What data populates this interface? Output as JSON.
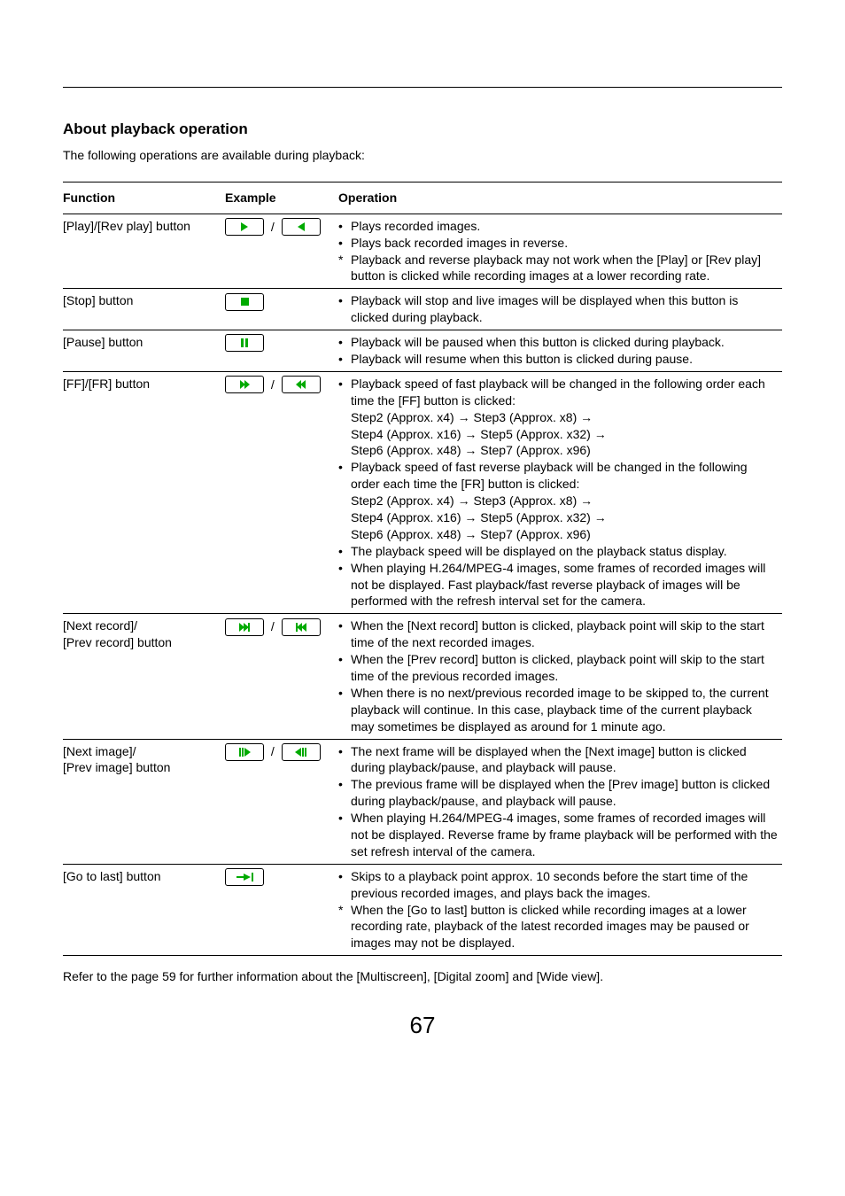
{
  "section_title": "About playback operation",
  "intro": "The following operations are available during playback:",
  "table": {
    "headers": {
      "fn": "Function",
      "ex": "Example",
      "op": "Operation"
    },
    "rows": [
      {
        "fn": "[Play]/[Rev play] button",
        "sep": "/",
        "op": [
          {
            "m": "•",
            "t": "Plays recorded images."
          },
          {
            "m": "•",
            "t": "Plays back recorded images in reverse."
          },
          {
            "m": "*",
            "t": "Playback and reverse playback may not work when the [Play] or [Rev play] button is clicked while recording images at a lower recording rate."
          }
        ]
      },
      {
        "fn": "[Stop] button",
        "op": [
          {
            "m": "•",
            "t": "Playback will stop and live images will be displayed when this button is clicked during playback."
          }
        ]
      },
      {
        "fn": "[Pause] button",
        "op": [
          {
            "m": "•",
            "t": "Playback will be paused when this button is clicked during playback."
          },
          {
            "m": "•",
            "t": "Playback will resume when this button is clicked during pause."
          }
        ]
      },
      {
        "fn": "[FF]/[FR] button",
        "sep": "/",
        "op": [
          {
            "m": "•",
            "t": "Playback speed of fast playback will be changed in the following order each time the [FF] button is clicked:"
          },
          {
            "m": "",
            "t": "Step2 (Approx. x4) → Step3 (Approx. x8) →"
          },
          {
            "m": "",
            "t": "Step4 (Approx. x16) → Step5 (Approx. x32) →"
          },
          {
            "m": "",
            "t": "Step6 (Approx. x48) → Step7 (Approx. x96)"
          },
          {
            "m": "•",
            "t": "Playback speed of fast reverse playback will be changed in the following order each time the [FR] button is clicked:"
          },
          {
            "m": "",
            "t": "Step2 (Approx. x4) → Step3 (Approx. x8) →"
          },
          {
            "m": "",
            "t": "Step4 (Approx. x16) → Step5 (Approx. x32) →"
          },
          {
            "m": "",
            "t": "Step6 (Approx. x48) → Step7 (Approx. x96)"
          },
          {
            "m": "•",
            "t": "The playback speed will be displayed on the playback status display."
          },
          {
            "m": "•",
            "t": "When playing H.264/MPEG-4 images, some frames of recorded images will not be displayed. Fast playback/fast reverse playback of images will be performed with the refresh interval set for the camera."
          }
        ]
      },
      {
        "fn1": "[Next record]/",
        "fn2": "[Prev record] button",
        "sep": "/",
        "op": [
          {
            "m": "•",
            "t": "When the [Next record] button is clicked, playback point will skip to the start time of the next recorded images."
          },
          {
            "m": "•",
            "t": "When the [Prev record] button is clicked, playback point will skip to the start time of the previous recorded images."
          },
          {
            "m": "•",
            "t": "When there is no next/previous recorded image to be skipped to, the current playback will continue. In this case, playback time of the current playback may sometimes be displayed as around for 1 minute ago."
          }
        ]
      },
      {
        "fn1": "[Next image]/",
        "fn2": "[Prev image] button",
        "sep": "/",
        "op": [
          {
            "m": "•",
            "t": "The next frame will be displayed when the [Next image] button is clicked during playback/pause, and playback will pause."
          },
          {
            "m": "•",
            "t": "The previous frame will be displayed when the [Prev image] button is clicked during playback/pause, and playback will pause."
          },
          {
            "m": "•",
            "t": "When playing H.264/MPEG-4 images, some frames of recorded images will not be displayed. Reverse frame by frame playback will be performed with the set refresh interval of the camera."
          }
        ]
      },
      {
        "fn": "[Go to last] button",
        "op": [
          {
            "m": "•",
            "t": "Skips to a playback point approx. 10 seconds before the start time of the previous recorded images, and plays back the images."
          },
          {
            "m": "*",
            "t": "When the [Go to last] button is clicked while recording images at a lower recording rate, playback of the latest recorded images may be paused or images may not be displayed."
          }
        ]
      }
    ]
  },
  "footnote": "Refer to the page 59 for further information about the [Multiscreen], [Digital zoom] and [Wide view].",
  "page_number": "67"
}
